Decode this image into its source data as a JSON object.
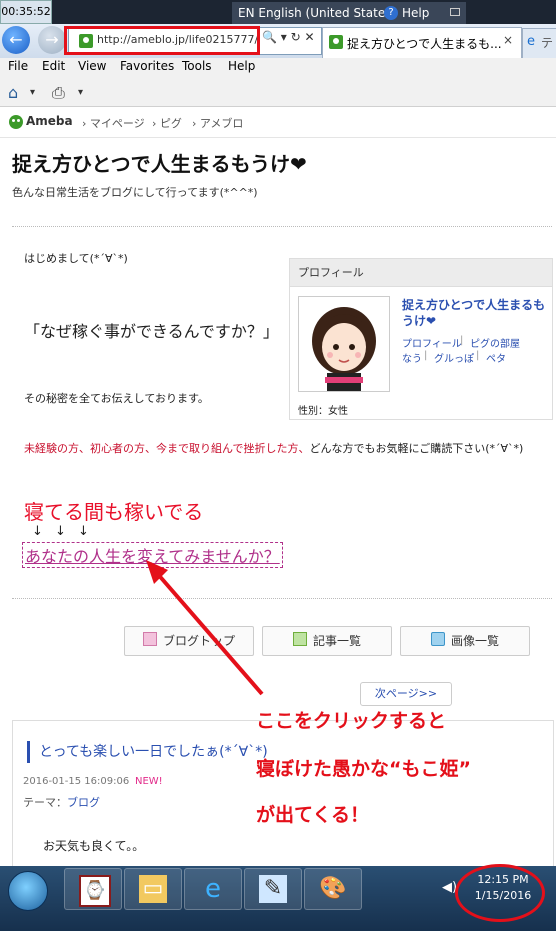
{
  "system": {
    "top_clock": "00:35:52",
    "language": "EN English (United States)",
    "help": "Help"
  },
  "browser": {
    "url": "http://ameblo.jp/life0215777/",
    "tab_title": "捉え方ひとつで人生まるも...",
    "tab_close": "×",
    "tab_new": "テ",
    "menu": [
      "File",
      "Edit",
      "View",
      "Favorites",
      "Tools",
      "Help"
    ]
  },
  "ameba_bar": {
    "logo": "Ameba",
    "items": [
      "マイページ",
      "ピグ",
      "アメブロ"
    ]
  },
  "blog": {
    "title": "捉え方ひとつで人生まるもうけ❤",
    "description": "色んな日常生活をブログにして行ってます(*^^*)",
    "greeting": "はじめまして(*´∀`*)",
    "question": "「なぜ稼ぐ事ができるんですか？」",
    "secret": "その秘密を全てお伝えしております。",
    "invite_red": "未経験の方、初心者の方、今まで取り組んで挫折した方、",
    "invite_black": "どんな方でもお気軽にご購読下さい(*´∀`*)",
    "sleep": "寝てる間も稼いでる",
    "arrows": "↓ ↓ ↓",
    "cta": "あなたの人生を変えてみませんか？"
  },
  "profile": {
    "header": "プロフィール",
    "name": "捉え方ひとつで人生まるもうけ❤",
    "links": [
      "プロフィール",
      "ピグの部屋",
      "なう",
      "グルっぽ",
      "ペタ"
    ],
    "separator": "|",
    "sex": "性別：女性"
  },
  "nav": {
    "top": "ブログトップ",
    "articles": "記事一覧",
    "images": "画像一覧",
    "next": "次ページ>>"
  },
  "article": {
    "title": "とっても楽しい一日でしたぁ(*´∀`*)",
    "date": "2016-01-15 16:09:06",
    "new": "NEW!",
    "theme_label": "テーマ：",
    "theme": "ブログ",
    "body": "お天気も良くて。。"
  },
  "annotations": {
    "line1": "ここをクリックすると",
    "line2": "寝ぼけた愚かな“もこ姫”",
    "line3": "が出てくる！"
  },
  "taskbar": {
    "time": "12:15 PM",
    "date": "1/15/2016"
  },
  "colors": {
    "annotation_red": "#e4101a",
    "link_blue": "#2a4fb0",
    "cta_pink": "#b0308a",
    "invite_red": "#c8102e"
  }
}
